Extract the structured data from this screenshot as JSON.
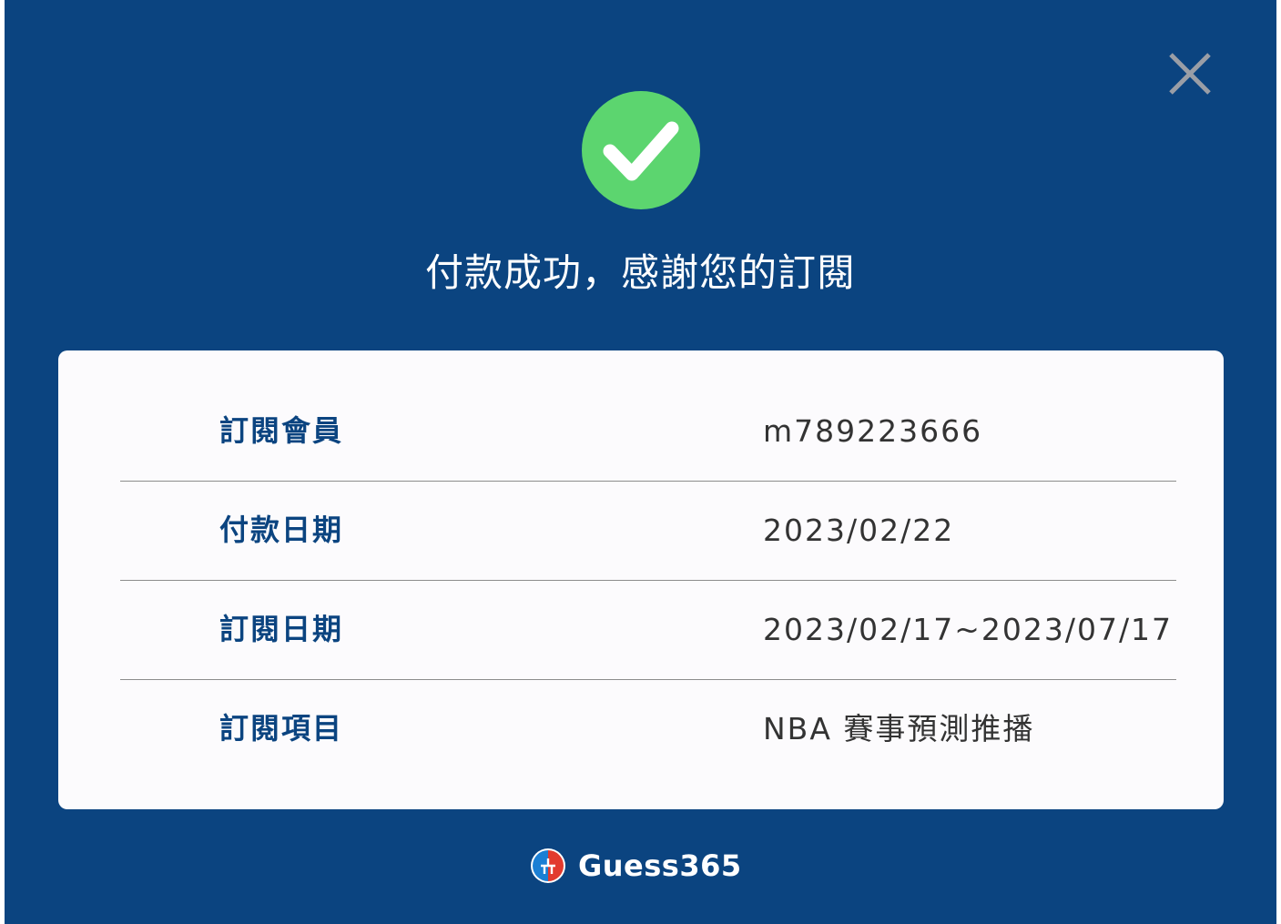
{
  "dialog": {
    "title": "付款成功，感謝您的訂閱",
    "close_icon": "close-icon",
    "success_icon": "check-circle-icon"
  },
  "details": {
    "rows": [
      {
        "label": "訂閱會員",
        "value": "m789223666"
      },
      {
        "label": "付款日期",
        "value": "2023/02/22"
      },
      {
        "label": "訂閱日期",
        "value": "2023/02/17~2023/07/17"
      },
      {
        "label": "訂閱項目",
        "value": "NBA 賽事預測推播"
      }
    ]
  },
  "brand": {
    "name": "Guess365",
    "logo_icon": "guess365-logo-icon"
  },
  "colors": {
    "background": "#0b4480",
    "card": "#fcfbfd",
    "success": "#5cd56f",
    "label": "#0b4480",
    "value": "#333333",
    "close": "#9a9ea6"
  }
}
